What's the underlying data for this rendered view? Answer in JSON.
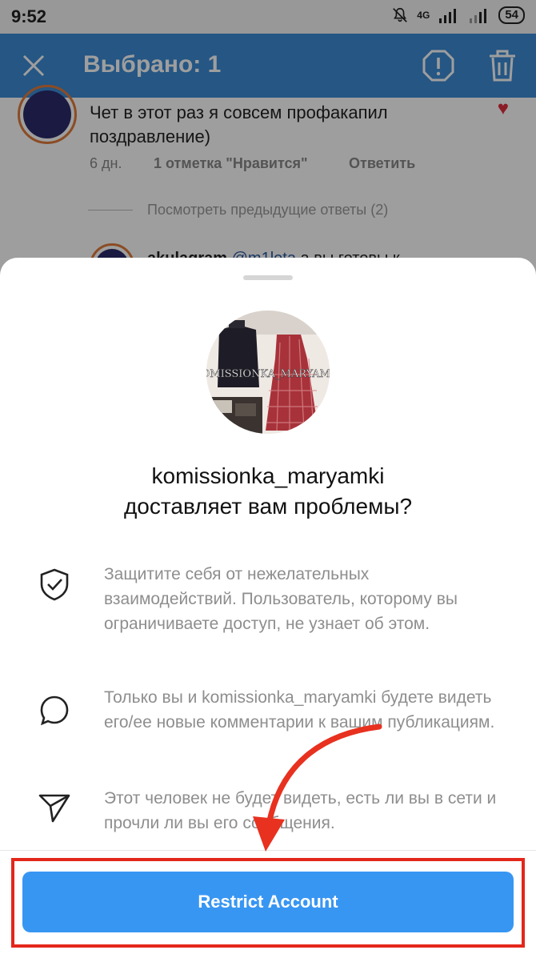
{
  "status_bar": {
    "time": "9:52",
    "network": "4G",
    "battery": "54"
  },
  "app_bar": {
    "title": "Выбрано: 1",
    "icons": [
      "close-icon",
      "report-icon",
      "trash-icon"
    ]
  },
  "background_comments": {
    "comment1_text": "Чет в этот раз я совсем профакапил поздравление)",
    "age": "6 дн.",
    "likes": "1 отметка \"Нравится\"",
    "reply": "Ответить",
    "view_previous": "Посмотреть предыдущие ответы (2)",
    "comment2_user": "akulagram",
    "comment2_mention": "@m1lota",
    "comment2_text": " а вы готовы к"
  },
  "sheet": {
    "profile_watermark": "KOMISSIONKA_MARYAMKI",
    "headline_line1": "komissionka_maryamki",
    "headline_line2": "доставляет вам проблемы?",
    "items": [
      {
        "icon": "shield-check-icon",
        "text": "Защитите себя от нежелательных взаимодействий. Пользователь, которому вы ограничиваете доступ, не узнает об этом."
      },
      {
        "icon": "speech-bubble-icon",
        "text": "Только вы и komissionka_maryamki будете видеть его/ее новые комментарии к вашим публикациям."
      },
      {
        "icon": "paper-plane-icon",
        "text": "Этот человек не будет видеть, есть ли вы в сети и прочли ли вы его сообщения."
      }
    ],
    "button_label": "Restrict Account"
  },
  "colors": {
    "app_bar": "#3d8cd6",
    "button": "#3896f3",
    "highlight": "#e3271b",
    "arrow": "#e8311f"
  }
}
